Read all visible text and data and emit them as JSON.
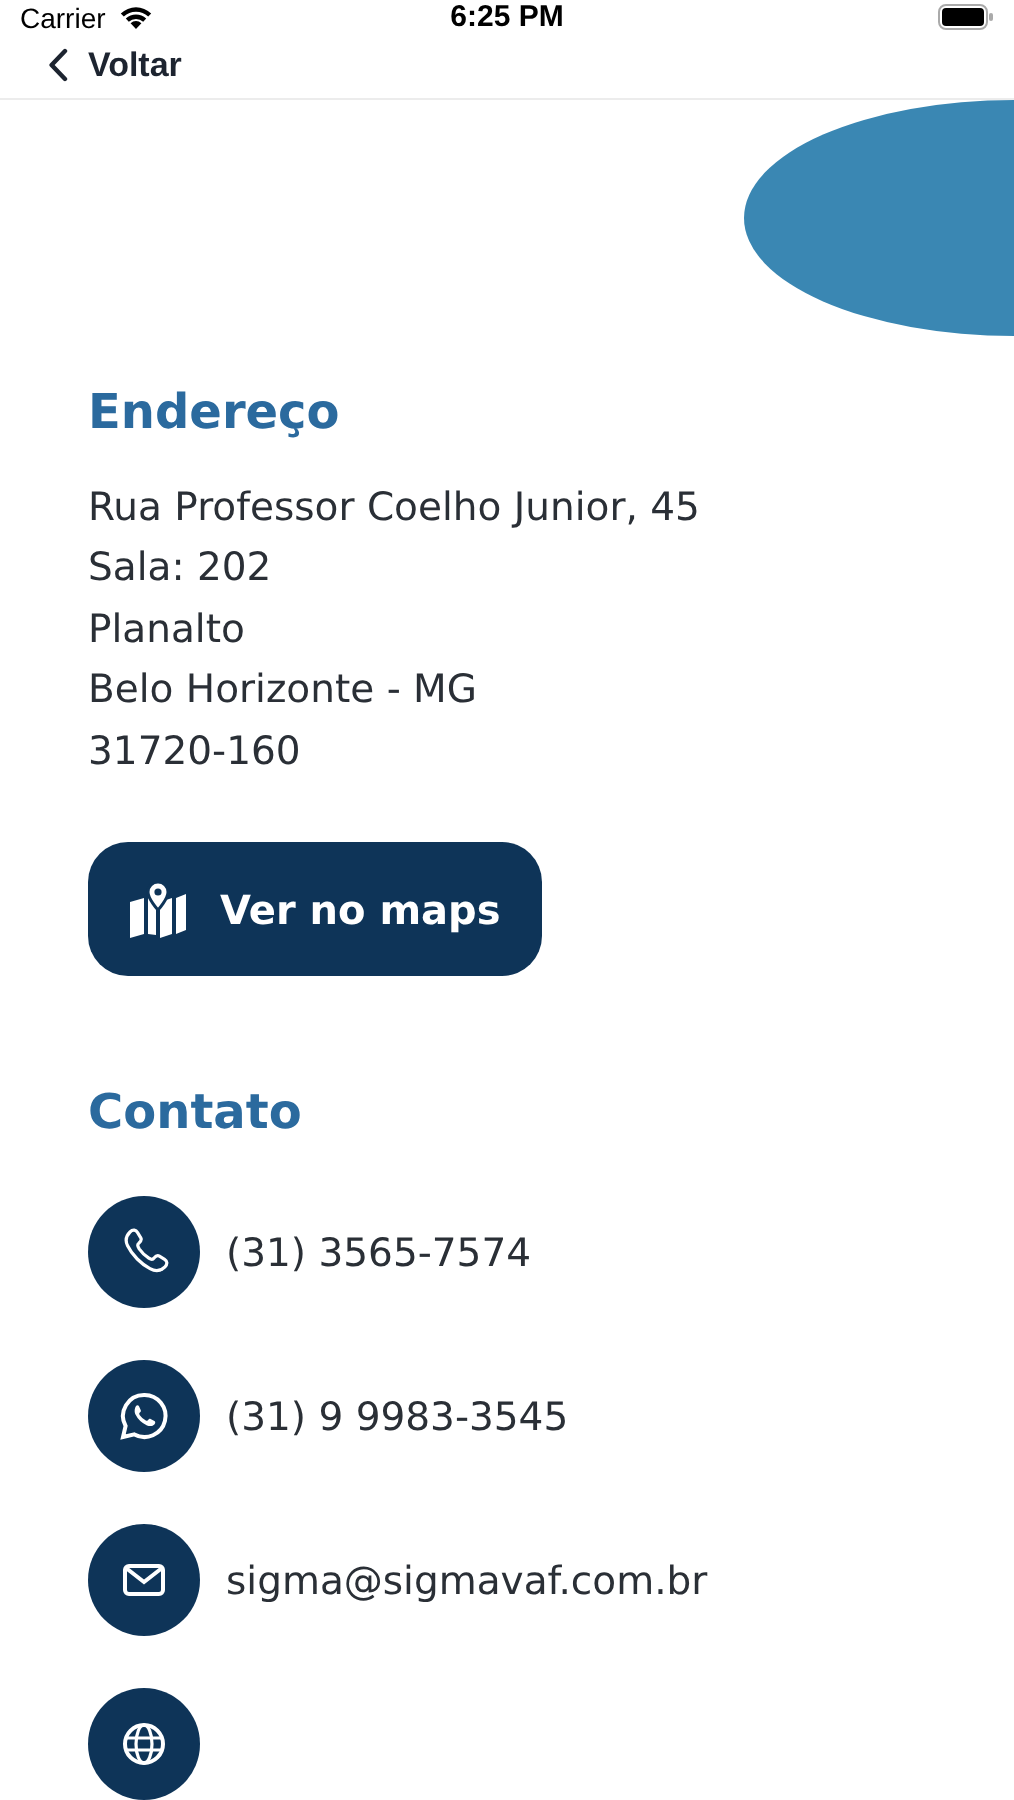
{
  "status_bar": {
    "carrier": "Carrier",
    "time": "6:25 PM"
  },
  "nav": {
    "back_label": "Voltar"
  },
  "address": {
    "heading": "Endereço",
    "lines": [
      "Rua Professor Coelho Junior, 45",
      "Sala: 202",
      "Planalto",
      "Belo Horizonte - MG",
      "31720-160"
    ],
    "button": "Ver no maps"
  },
  "contact": {
    "heading": "Contato",
    "items": [
      {
        "kind": "phone",
        "text": "(31) 3565-7574"
      },
      {
        "kind": "whatsapp",
        "text": "(31) 9 9983-3545"
      },
      {
        "kind": "email",
        "text": "sigma@sigmavaf.com.br"
      },
      {
        "kind": "web"
      }
    ]
  }
}
